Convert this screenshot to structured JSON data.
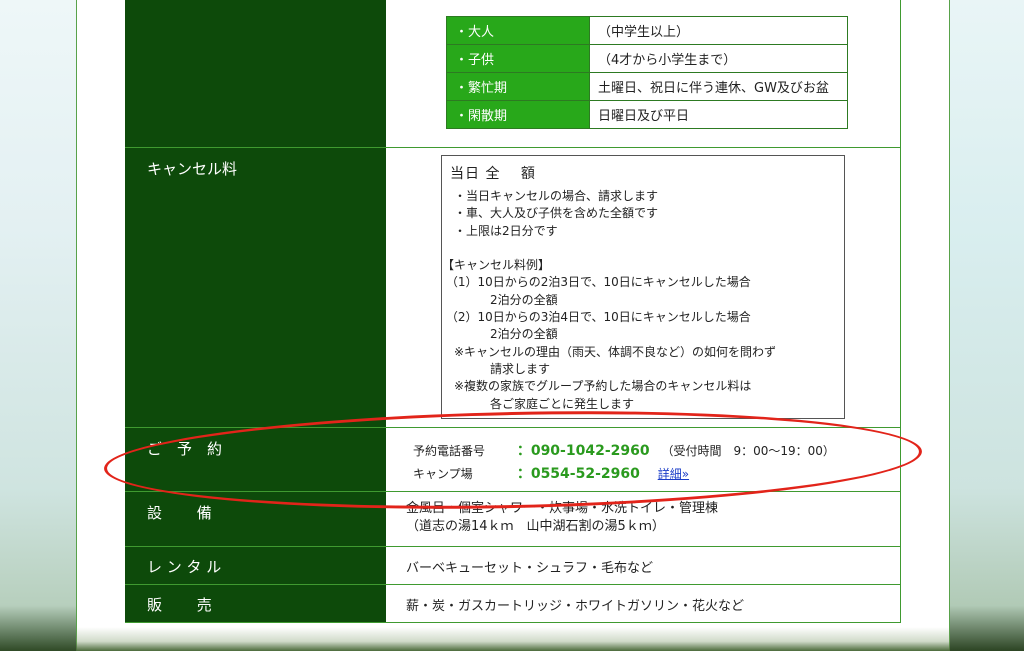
{
  "rates": [
    {
      "key": "・大人",
      "value": "（中学生以上）"
    },
    {
      "key": "・子供",
      "value": "（4才から小学生まで）"
    },
    {
      "key": "・繁忙期",
      "value": "土曜日、祝日に伴う連休、GW及びお盆"
    },
    {
      "key": "・閑散期",
      "value": "日曜日及び平日"
    }
  ],
  "cancel": {
    "label": "キャンセル料",
    "title": "当日 全　 額",
    "lines": [
      "　・当日キャンセルの場合、請求します",
      "　・車、大人及び子供を含めた全額です",
      "　・上限は2日分です",
      "",
      "【キャンセル料例】",
      " （1）10日からの2泊3日で、10日にキャンセルした場合",
      "　　　　2泊分の全額",
      " （2）10日からの3泊4日で、10日にキャンセルした場合",
      "　　　　2泊分の全額",
      "　※キャンセルの理由（雨天、体調不良など）の如何を問わず",
      "　　　　請求します",
      "　※複数の家族でグループ予約した場合のキャンセル料は",
      "　　　　各ご家庭ごとに発生します"
    ]
  },
  "reservation": {
    "label": "ご　予　約",
    "phone_label": "予約電話番号",
    "phone_number": "：090-1042-2960",
    "phone_hours": "（受付時間　9：00〜19：00）",
    "camp_label": "キャンプ場",
    "camp_number": "：0554-52-2960",
    "detail_link": "詳細»"
  },
  "facilities": {
    "label": "設　　 備",
    "line1": "金風呂・個室シャワー・炊事場・水洗トイレ・管理棟",
    "line2": "（道志の湯14ｋｍ　山中湖石割の湯5ｋｍ）"
  },
  "rental": {
    "label": "レ ン タ ル",
    "text": "バーベキューセット・シュラフ・毛布など"
  },
  "sales": {
    "label": "販　　 売",
    "text": "薪・炭・ガスカートリッジ・ホワイトガソリン・花火など"
  },
  "colors": {
    "label_bg": "#0d4a0a",
    "rate_key_bg": "#28a81a",
    "highlight": "#e2241a",
    "phone_green": "#2a9a1e",
    "link_blue": "#1a3cc8"
  }
}
